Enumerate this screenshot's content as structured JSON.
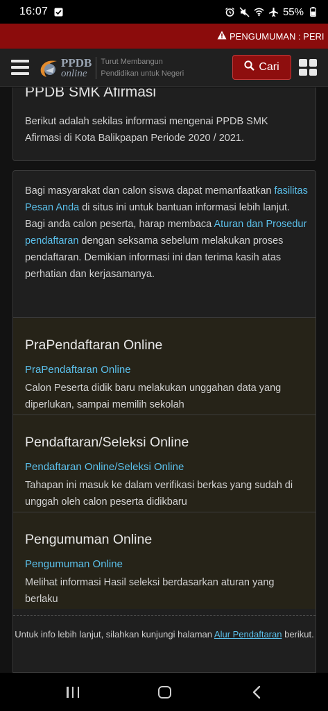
{
  "status_bar": {
    "time": "16:07",
    "battery": "55%",
    "icons": [
      "checkbox-icon",
      "alarm-icon",
      "mute-icon",
      "wifi-icon",
      "airplane-icon",
      "battery-icon"
    ]
  },
  "announcement": {
    "label": "PENGUMUMAN : PERI"
  },
  "header": {
    "logo_ppdb": "PPDB",
    "logo_online": "online",
    "tagline_line1": "Turut Membangun",
    "tagline_line2": "Pendidikan untuk Negeri",
    "search_label": "Cari",
    "accent_color": "#8e0e0e"
  },
  "intro": {
    "title": "PPDB SMK Afirmasi",
    "text": "Berikut adalah sekilas informasi mengenai PPDB SMK Afirmasi di Kota Balikpapan Periode 2020 / 2021."
  },
  "info": {
    "part1": "Bagi masyarakat dan calon siswa dapat memanfaatkan ",
    "link1": "fasilitas Pesan Anda",
    "part2": " di situs ini untuk bantuan informasi lebih lanjut. Bagi anda calon peserta, harap membaca ",
    "link2": "Aturan dan Prosedur pendaftaran",
    "part3": " dengan seksama sebelum melakukan proses pendaftaran. Demikian informasi ini dan terima kasih atas perhatian dan kerjasamanya."
  },
  "steps": [
    {
      "title": "PraPendaftaran Online",
      "link": "PraPendaftaran Online",
      "desc": "Calon Peserta didik baru melakukan unggahan data yang diperlukan, sampai memilih sekolah"
    },
    {
      "title": "Pendaftaran/Seleksi Online",
      "link": "Pendaftaran Online/Seleksi Online",
      "desc": "Tahapan ini masuk ke dalam verifikasi berkas yang sudah di unggah oleh calon peserta didikbaru"
    },
    {
      "title": "Pengumuman Online",
      "link": "Pengumuman Online",
      "desc": "Melihat informasi Hasil seleksi berdasarkan aturan yang berlaku"
    }
  ],
  "footer": {
    "before": "Untuk info lebih lanjut, silahkan kunjungi halaman ",
    "link": "Alur Pendaftaran",
    "after": " berikut."
  }
}
